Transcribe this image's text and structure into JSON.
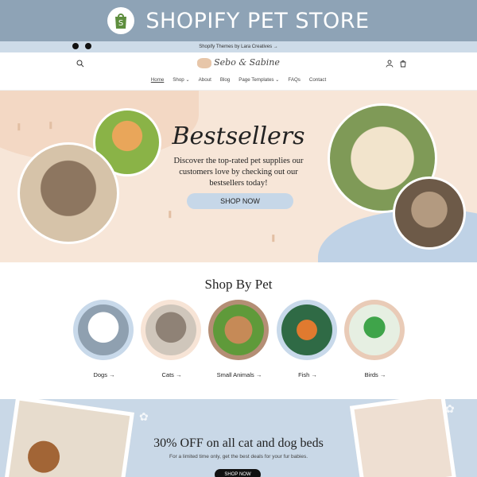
{
  "banner": {
    "title": "SHOPIFY PET STORE"
  },
  "announcement": {
    "text": "Shopify Themes by Lara Creatives →"
  },
  "header": {
    "brand": "Sebo & Sabine"
  },
  "nav": {
    "items": [
      {
        "label": "Home",
        "active": true
      },
      {
        "label": "Shop ⌄"
      },
      {
        "label": "About"
      },
      {
        "label": "Blog"
      },
      {
        "label": "Page Templates ⌄"
      },
      {
        "label": "FAQs"
      },
      {
        "label": "Contact"
      }
    ]
  },
  "hero": {
    "heading": "Bestsellers",
    "description": "Discover the top-rated pet supplies our customers love by checking out our bestsellers today!",
    "button": "SHOP NOW"
  },
  "shop_by_pet": {
    "title": "Shop By Pet",
    "items": [
      {
        "label": "Dogs →",
        "ring": "#c8d9ea",
        "color": "#f4f4f4"
      },
      {
        "label": "Cats →",
        "ring": "#f7e4d6",
        "color": "#8f8276"
      },
      {
        "label": "Small Animals →",
        "ring": "#b48e75",
        "color": "#c68a57"
      },
      {
        "label": "Fish →",
        "ring": "#c8d9ea",
        "color": "#e07a2f"
      },
      {
        "label": "Birds →",
        "ring": "#e9cbb7",
        "color": "#3fa44a"
      }
    ]
  },
  "promo": {
    "headline": "30% OFF on all cat and dog beds",
    "subtext": "For a limited time only, get the best deals for your fur babies.",
    "button": "SHOP NOW"
  },
  "colors": {
    "banner": "#8ea3b6",
    "announcement": "#cddbe8",
    "hero_bg": "#f7e6d8",
    "accent_blue": "#c6d7e8"
  }
}
